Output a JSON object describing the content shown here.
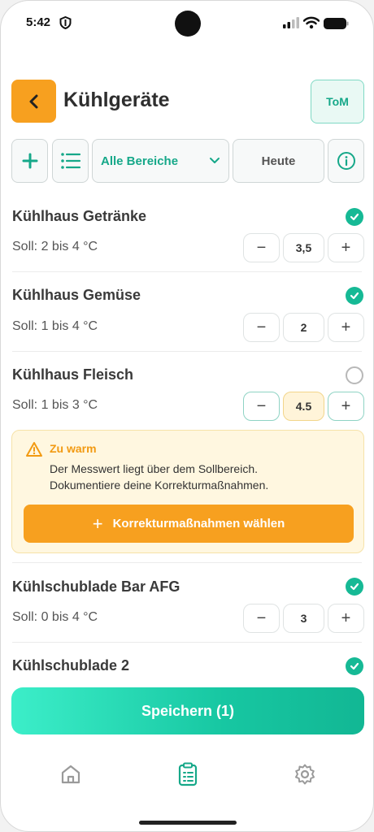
{
  "status": {
    "time": "5:42"
  },
  "header": {
    "title": "Kühlgeräte",
    "avatar_initials": "ToM"
  },
  "toolbar": {
    "area_select": "Alle Bereiche",
    "date": "Heute"
  },
  "items": [
    {
      "name": "Kühlhaus Getränke",
      "soll": "Soll: 2 bis 4 °C",
      "value": "3,5",
      "checked": true
    },
    {
      "name": "Kühlhaus Gemüse",
      "soll": "Soll: 1 bis 4 °C",
      "value": "2",
      "checked": true
    },
    {
      "name": "Kühlhaus Fleisch",
      "soll": "Soll: 1 bis 3 °C",
      "value": "4.5",
      "checked": false
    },
    {
      "name": "Kühlschublade Bar AFG",
      "soll": "Soll: 0 bis 4 °C",
      "value": "3",
      "checked": true
    },
    {
      "name": "Kühlschublade 2",
      "checked": true
    }
  ],
  "stepper": {
    "minus": "−",
    "plus": "+"
  },
  "warning": {
    "title": "Zu warm",
    "line1": "Der Messwert liegt über dem Sollbereich.",
    "line2": "Dokumentiere deine Korrekturmaßnahmen.",
    "button_plus": "+",
    "button": "Korrekturmaßnahmen wählen"
  },
  "save_button": "Speichern (1)",
  "colors": {
    "accent_orange": "#f7a01f",
    "accent_teal": "#16b995",
    "warning_bg": "#fff7e0"
  },
  "nav": {
    "icons": [
      "home-icon",
      "clipboard-icon",
      "gear-icon"
    ]
  }
}
